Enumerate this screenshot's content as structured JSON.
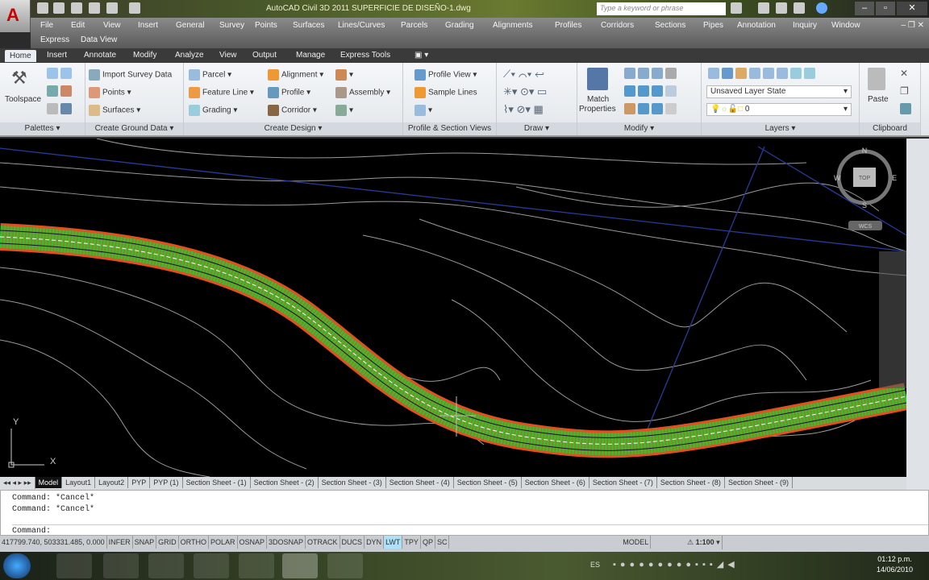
{
  "title": "AutoCAD Civil 3D 2011    SUPERFICIE DE DISEÑO-1.dwg",
  "search_placeholder": "Type a keyword or phrase",
  "menu": [
    "File",
    "Edit",
    "View",
    "Insert",
    "General",
    "Survey",
    "Points",
    "Surfaces",
    "Lines/Curves",
    "Parcels",
    "Grading",
    "Alignments",
    "Profiles",
    "Corridors",
    "Sections",
    "Pipes",
    "Annotation",
    "Inquiry",
    "Window",
    "Express",
    "Data View"
  ],
  "tabs": [
    "Home",
    "Insert",
    "Annotate",
    "Modify",
    "Analyze",
    "View",
    "Output",
    "Manage",
    "Express Tools"
  ],
  "ribbon": {
    "toolspace": "Toolspace",
    "palettes": "Palettes ▾",
    "import_survey": "Import Survey Data",
    "points": "Points ▾",
    "surfaces": "Surfaces ▾",
    "create_ground": "Create Ground Data ▾",
    "parcel": "Parcel ▾",
    "feature_line": "Feature Line ▾",
    "grading": "Grading ▾",
    "alignment": "Alignment ▾",
    "profile": "Profile ▾",
    "corridor": "Corridor ▾",
    "assembly": "Assembly ▾",
    "create_design": "Create Design ▾",
    "profile_view": "Profile View ▾",
    "sample_lines": "Sample Lines",
    "profile_section": "Profile & Section Views",
    "draw": "Draw ▾",
    "match": "Match",
    "properties": "Properties",
    "modify": "Modify ▾",
    "layer_state": "Unsaved Layer State",
    "layer": "0",
    "layers": "Layers ▾",
    "paste": "Paste",
    "clipboard": "Clipboard"
  },
  "viewcube": {
    "n": "N",
    "s": "S",
    "e": "E",
    "w": "W",
    "top": "TOP",
    "wcs": "WCS"
  },
  "layout_tabs": [
    "Model",
    "Layout1",
    "Layout2",
    "PYP",
    "PYP (1)",
    "Section Sheet - (1)",
    "Section Sheet - (2)",
    "Section Sheet - (3)",
    "Section Sheet - (4)",
    "Section Sheet - (5)",
    "Section Sheet - (6)",
    "Section Sheet - (7)",
    "Section Sheet - (8)",
    "Section Sheet - (9)"
  ],
  "command_history": [
    "Command: *Cancel*",
    "Command: *Cancel*"
  ],
  "command_prompt": "Command:",
  "status": {
    "coords": "417799.740, 503331.485, 0.000",
    "toggles": [
      "INFER",
      "SNAP",
      "GRID",
      "ORTHO",
      "POLAR",
      "OSNAP",
      "3DOSNAP",
      "OTRACK",
      "DUCS",
      "DYN",
      "LWT",
      "TPY",
      "QP",
      "SC"
    ],
    "active": "LWT",
    "model": "MODEL",
    "scale": "1:100"
  },
  "taskbar": {
    "lang": "ES",
    "time": "01:12 p.m.",
    "date": "14/06/2010"
  },
  "ucs": {
    "x": "X",
    "y": "Y"
  }
}
